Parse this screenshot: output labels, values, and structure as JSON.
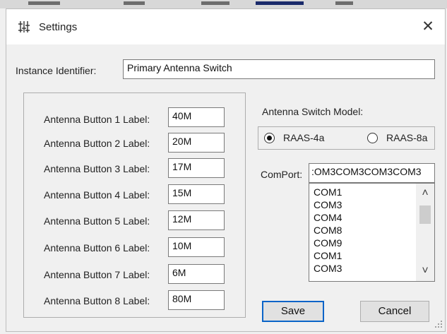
{
  "window": {
    "title": "Settings",
    "close_glyph": "✕"
  },
  "instance": {
    "label": "Instance Identifier:",
    "value": "Primary Antenna Switch"
  },
  "antenna_buttons": [
    {
      "label": "Antenna Button 1 Label:",
      "value": "40M"
    },
    {
      "label": "Antenna Button 2 Label:",
      "value": "20M"
    },
    {
      "label": "Antenna Button 3 Label:",
      "value": "17M"
    },
    {
      "label": "Antenna Button 4 Label:",
      "value": "15M"
    },
    {
      "label": "Antenna Button 5 Label:",
      "value": "12M"
    },
    {
      "label": "Antenna Button 6 Label:",
      "value": "10M"
    },
    {
      "label": "Antenna Button 7 Label:",
      "value": "6M"
    },
    {
      "label": "Antenna Button 8 Label:",
      "value": "80M"
    }
  ],
  "model": {
    "label": "Antenna Switch Model:",
    "options": [
      {
        "label": "RAAS-4a",
        "selected": true
      },
      {
        "label": "RAAS-8a",
        "selected": false
      }
    ]
  },
  "comport": {
    "label": "ComPort:",
    "value": ":OM3COM3COM3COM3",
    "list_items": [
      "COM1",
      "COM3",
      "COM4",
      "COM8",
      "COM9",
      "COM1",
      "COM3"
    ],
    "scroll_up_glyph": "˄",
    "scroll_down_glyph": "˅"
  },
  "buttons": {
    "save": "Save",
    "cancel": "Cancel"
  },
  "colors": {
    "default_button_border": "#0a64c8",
    "title_bar": "#ffffff",
    "dialog_bg": "#f0f0f0"
  }
}
